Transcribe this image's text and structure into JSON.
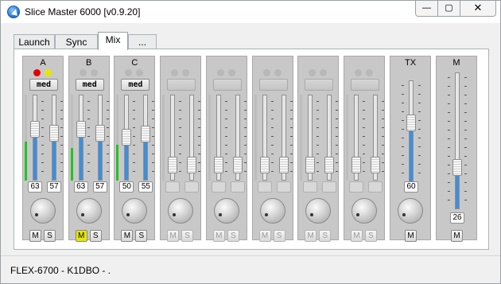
{
  "window": {
    "title": "Slice Master 6000 [v0.9.20]",
    "minimize_glyph": "—",
    "maximize_glyph": "▢",
    "close_glyph": "✕"
  },
  "tabs": [
    {
      "label": "Launch",
      "active": false
    },
    {
      "label": "Sync",
      "active": false
    },
    {
      "label": "Mix",
      "active": true
    },
    {
      "label": "...",
      "active": false
    }
  ],
  "strips": [
    {
      "label": "A",
      "led1": "red",
      "led2": "yellow",
      "mode": "med",
      "enabled": true,
      "meter": 0.45,
      "vol": 63,
      "pan": 57,
      "mute": "M",
      "solo": "S",
      "mute_active": false
    },
    {
      "label": "B",
      "led1": "off",
      "led2": "off",
      "mode": "med",
      "enabled": true,
      "meter": 0.38,
      "vol": 63,
      "pan": 57,
      "mute": "M",
      "solo": "S",
      "mute_active": true
    },
    {
      "label": "C",
      "led1": "off",
      "led2": "off",
      "mode": "med",
      "enabled": true,
      "meter": 0.42,
      "vol": 50,
      "pan": 55,
      "mute": "M",
      "solo": "S",
      "mute_active": false
    },
    {
      "label": "",
      "led1": "off",
      "led2": "off",
      "mode": "",
      "enabled": false,
      "meter": 0,
      "vol": 0,
      "pan": 0,
      "mute": "M",
      "solo": "S",
      "mute_active": false
    },
    {
      "label": "",
      "led1": "off",
      "led2": "off",
      "mode": "",
      "enabled": false,
      "meter": 0,
      "vol": 0,
      "pan": 0,
      "mute": "M",
      "solo": "S",
      "mute_active": false
    },
    {
      "label": "",
      "led1": "off",
      "led2": "off",
      "mode": "",
      "enabled": false,
      "meter": 0,
      "vol": 0,
      "pan": 0,
      "mute": "M",
      "solo": "S",
      "mute_active": false
    },
    {
      "label": "",
      "led1": "off",
      "led2": "off",
      "mode": "",
      "enabled": false,
      "meter": 0,
      "vol": 0,
      "pan": 0,
      "mute": "M",
      "solo": "S",
      "mute_active": false
    },
    {
      "label": "",
      "led1": "off",
      "led2": "off",
      "mode": "",
      "enabled": false,
      "meter": 0,
      "vol": 0,
      "pan": 0,
      "mute": "M",
      "solo": "S",
      "mute_active": false
    }
  ],
  "tx": {
    "label": "TX",
    "level": 60,
    "mute": "M"
  },
  "master": {
    "label": "M",
    "level": 26,
    "mute": "M"
  },
  "status": "FLEX-6700 - K1DBO - ."
}
